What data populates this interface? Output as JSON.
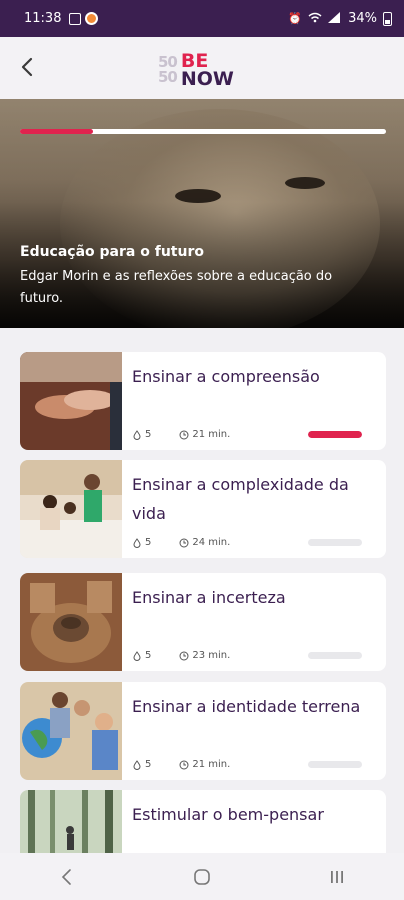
{
  "status": {
    "time": "11:38",
    "battery": "34%"
  },
  "logo": {
    "top_mark": "50",
    "bottom_mark": "50",
    "line1": "BE",
    "line2": "NOW"
  },
  "hero": {
    "title": "Educação para o futuro",
    "subtitle": "Edgar Morin e as reflexões sobre a educação do futuro.",
    "progress": 0.2
  },
  "lessons": [
    {
      "title": "Ensinar a compreensão",
      "count": "5",
      "duration": "21 min.",
      "progress": 1.0,
      "thumb": "hands"
    },
    {
      "title": "Ensinar a complexidade da vida",
      "count": "5",
      "duration": "24 min.",
      "progress": 0.0,
      "thumb": "classroom"
    },
    {
      "title": "Ensinar a incerteza",
      "count": "5",
      "duration": "23 min.",
      "progress": 0.0,
      "thumb": "pottery"
    },
    {
      "title": "Ensinar a identidade terrena",
      "count": "5",
      "duration": "21 min.",
      "progress": 0.0,
      "thumb": "globe"
    },
    {
      "title": "Estimular o bem-pensar",
      "count": "",
      "duration": "",
      "progress": 0.0,
      "thumb": "forest"
    }
  ],
  "colors": {
    "brand_purple": "#3b1f50",
    "accent_red": "#e0234e"
  },
  "icons": {
    "count_icon": "drop-icon",
    "time_icon": "clock-icon"
  }
}
